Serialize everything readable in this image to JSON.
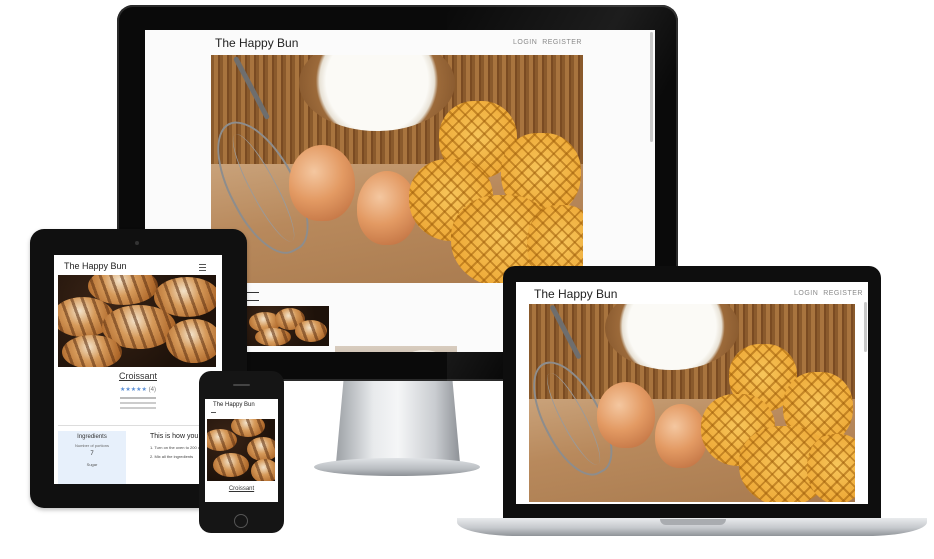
{
  "site": {
    "brand": "The Happy Bun",
    "nav_links": [
      "LOGIN",
      "REGISTER"
    ],
    "menu_icon": "hamburger-icon"
  },
  "recipe": {
    "title": "Croissant",
    "rating_count": "(4)",
    "ingredients_heading": "Ingredients",
    "ingredients_text": "Number of portions",
    "portions": "7",
    "sugar_label": "Sugar",
    "method_heading": "This is how you do it",
    "method_step1": "1. Turn on the oven to 200 deg.",
    "method_step2": "2. Mix all the ingredients"
  },
  "phone_recipe": {
    "title": "Croissant"
  },
  "colors": {
    "page_bg": "#ffffff",
    "device_bezel": "#0a0a0a",
    "link_color": "#8a8a8a",
    "star_color": "#5b8fd6",
    "ingredients_bg": "#e7f0fb"
  }
}
